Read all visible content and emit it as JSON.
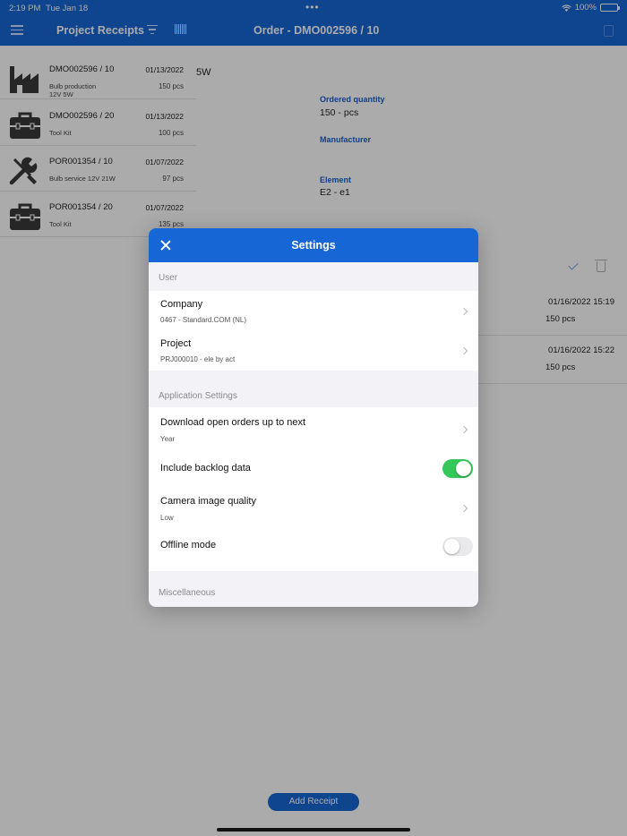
{
  "status_bar": {
    "time": "2:19 PM",
    "date": "Tue Jan 18",
    "dots": "•••",
    "battery": "100%"
  },
  "header": {
    "list_title": "Project Receipts",
    "order_title": "Order - DMO002596 / 10",
    "icons": [
      "menu-icon",
      "filter-icon",
      "barcode-icon",
      "document-icon"
    ]
  },
  "receipts_list": [
    {
      "icon": "factory-icon",
      "title": "DMO002596 / 10",
      "date": "01/13/2022",
      "sub": [
        "Bulb production",
        "12V 5W"
      ],
      "qty": "150 pcs"
    },
    {
      "icon": "toolbox-icon",
      "title": "DMO002596 / 20",
      "date": "01/13/2022",
      "sub": [
        "Tool Kit"
      ],
      "qty": "100 pcs"
    },
    {
      "icon": "tools-icon",
      "title": "POR001354 / 10",
      "date": "01/07/2022",
      "sub": [
        "Bulb service 12V 21W"
      ],
      "qty": "97 pcs"
    },
    {
      "icon": "toolbox-icon",
      "title": "POR001354 / 20",
      "date": "01/07/2022",
      "sub": [
        "Tool Kit"
      ],
      "qty": "135 pcs"
    }
  ],
  "detail": {
    "fragment": "5W",
    "ordered_quantity_label": "Ordered quantity",
    "ordered_quantity_value": "150  -  pcs",
    "manufacturer_label": "Manufacturer",
    "element_label": "Element",
    "element_value": "E2  -  e1",
    "receipts": [
      {
        "datetime": "01/16/2022 15:19",
        "qty": "150 pcs"
      },
      {
        "datetime": "01/16/2022 15:22",
        "qty": "150 pcs"
      }
    ],
    "add_receipt_label": "Add Receipt"
  },
  "settings": {
    "title": "Settings",
    "user_section": "User",
    "company_label": "Company",
    "company_value": "0467  -  Standard.COM (NL)",
    "project_label": "Project",
    "project_value": "PRJ000010  -  ele by act",
    "app_section": "Application Settings",
    "download_label": "Download open orders up to next",
    "download_value": "Year",
    "backlog_label": "Include backlog data",
    "backlog_on": true,
    "camera_label": "Camera image quality",
    "camera_value": "Low",
    "offline_label": "Offline mode",
    "offline_on": false,
    "misc_section": "Miscellaneous"
  }
}
